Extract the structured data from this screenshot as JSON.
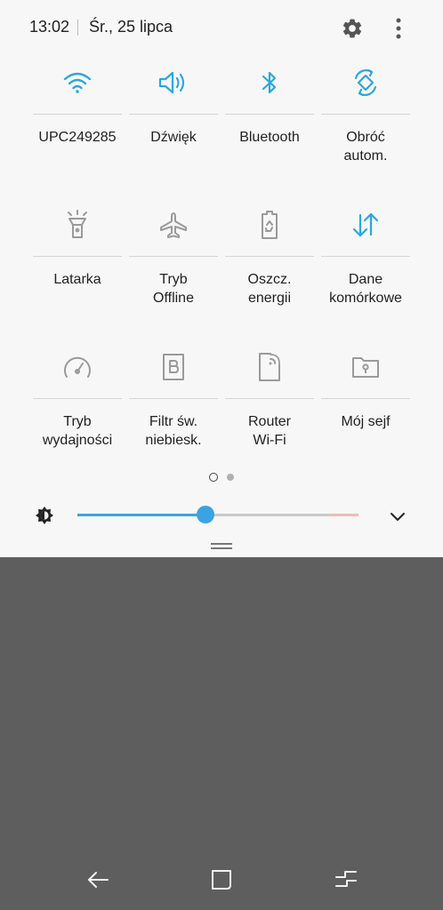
{
  "status": {
    "time": "13:02",
    "date": "Śr., 25 lipca"
  },
  "colors": {
    "active_icon": "#2aa7e0",
    "inactive_icon": "#9a9a9a",
    "slider": "#3ba3e0",
    "background": "#5e5e5e"
  },
  "tiles": [
    {
      "label": "UPC249285",
      "icon": "wifi-icon",
      "active": true
    },
    {
      "label": "Dźwięk",
      "icon": "sound-icon",
      "active": true
    },
    {
      "label": "Bluetooth",
      "icon": "bluetooth-icon",
      "active": true
    },
    {
      "label": "Obróć\nautom.",
      "icon": "auto-rotate-icon",
      "active": true
    },
    {
      "label": "Latarka",
      "icon": "flashlight-icon",
      "active": false
    },
    {
      "label": "Tryb\nOffline",
      "icon": "airplane-icon",
      "active": false
    },
    {
      "label": "Oszcz.\nenergii",
      "icon": "power-saving-icon",
      "active": false
    },
    {
      "label": "Dane\nkomórkowe",
      "icon": "mobile-data-icon",
      "active": true
    },
    {
      "label": "Tryb\nwydajności",
      "icon": "performance-icon",
      "active": false
    },
    {
      "label": "Filtr św.\nniebiesk.",
      "icon": "blue-light-filter-icon",
      "active": false
    },
    {
      "label": "Router\nWi-Fi",
      "icon": "hotspot-icon",
      "active": false
    },
    {
      "label": "Mój sejf",
      "icon": "secure-folder-icon",
      "active": false
    }
  ],
  "pager": {
    "current": 1,
    "total": 2
  },
  "brightness": {
    "level": 0.455
  },
  "navbar": {
    "back": "back-icon",
    "home": "home-icon",
    "recents": "recents-icon"
  }
}
